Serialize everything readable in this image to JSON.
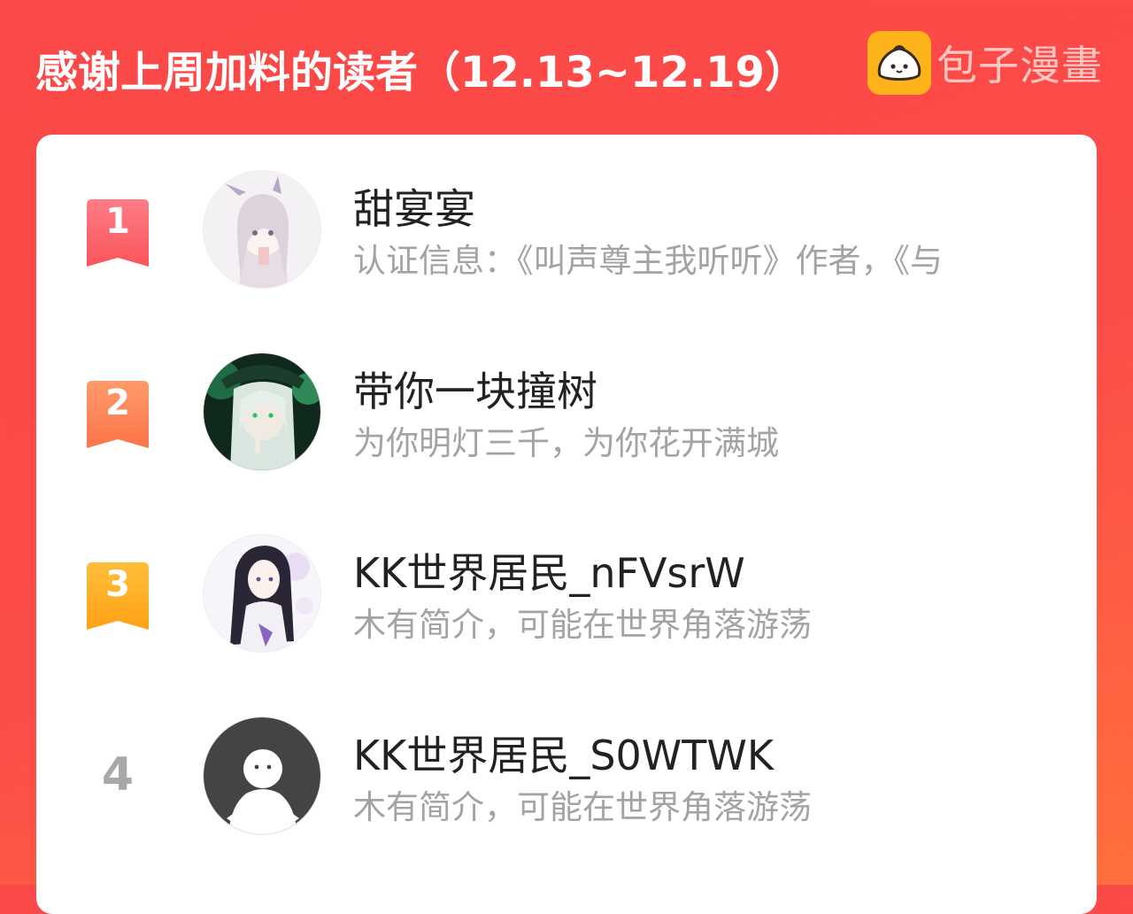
{
  "header": {
    "title": "感谢上周加料的读者（12.13~12.19）",
    "brand_name": "包子漫畫",
    "brand_icon": "bun-logo-icon"
  },
  "colors": {
    "background": "#fc4a49",
    "background_end": "#ff6f3c",
    "card": "#ffffff",
    "rank1": "#fa5a5f",
    "rank2": "#fc7a4d",
    "rank3": "#ffa41c",
    "rank_plain": "#a8a8a8",
    "name": "#222222",
    "bio": "#a3a3a3"
  },
  "readers": [
    {
      "rank": "1",
      "name": "甜宴宴",
      "bio": "认证信息：《叫声尊主我听听》作者，《与",
      "avatar_icon": "anime-girl-avatar"
    },
    {
      "rank": "2",
      "name": "带你一块撞树",
      "bio": "为你明灯三千，为你花开满城",
      "avatar_icon": "green-anime-avatar"
    },
    {
      "rank": "3",
      "name": "KK世界居民_nFVsrW",
      "bio": "木有简介，可能在世界角落游荡",
      "avatar_icon": "dark-hair-girl-avatar"
    },
    {
      "rank": "4",
      "name": "KK世界居民_S0WTWK",
      "bio": "木有简介，可能在世界角落游荡",
      "avatar_icon": "default-user-avatar"
    }
  ]
}
